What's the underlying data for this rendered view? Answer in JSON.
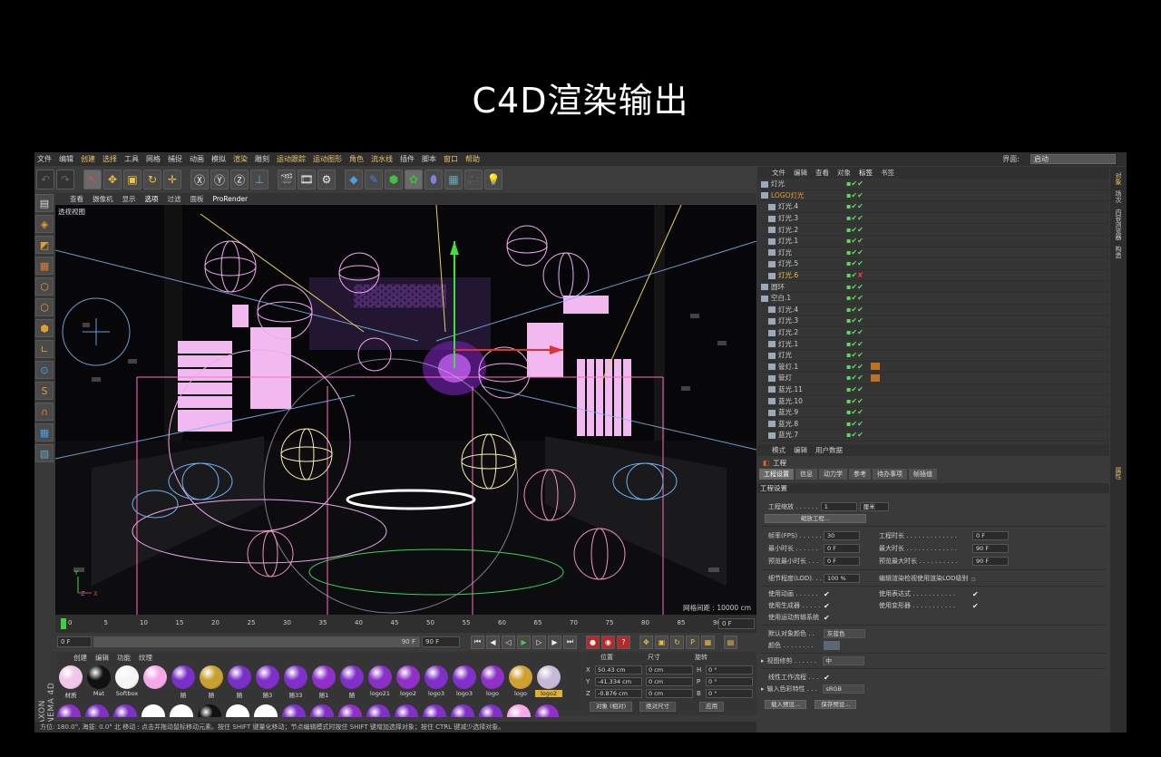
{
  "page_title": "C4D渲染输出",
  "menu": [
    "文件",
    "编辑",
    "创建",
    "选择",
    "工具",
    "网格",
    "捕捉",
    "动画",
    "模拟",
    "渲染",
    "雕刻",
    "运动跟踪",
    "运动图形",
    "角色",
    "流水线",
    "插件",
    "脚本",
    "窗口",
    "帮助"
  ],
  "interface": {
    "label": "界面:",
    "value": "启动"
  },
  "viewport": {
    "menu": [
      "查看",
      "摄像机",
      "显示",
      "选项",
      "过滤",
      "面板",
      "ProRender"
    ],
    "label": "透视视图",
    "grid_label": "网格间距 : 10000 cm"
  },
  "timeline": {
    "ticks": [
      "0",
      "5",
      "10",
      "15",
      "20",
      "25",
      "30",
      "35",
      "40",
      "45",
      "50",
      "55",
      "60",
      "65",
      "70",
      "75",
      "80",
      "85",
      "90"
    ],
    "current_frame": "0 F",
    "start": "0 F",
    "end": "90 F",
    "end2": "90 F"
  },
  "materials": {
    "menu": [
      "创建",
      "编辑",
      "功能",
      "纹理"
    ],
    "items": [
      {
        "name": "材质",
        "color": "#f2c6e8"
      },
      {
        "name": "Mat",
        "color": "#111111"
      },
      {
        "name": "Softbox",
        "color": "#f4f4f4"
      },
      {
        "name": "",
        "color": "#f4a8e8"
      },
      {
        "name": "随",
        "color": "#7a30c8"
      },
      {
        "name": "随",
        "color": "#c8a030"
      },
      {
        "name": "随",
        "color": "#7a30c8"
      },
      {
        "name": "随3",
        "color": "#8030c8"
      },
      {
        "name": "随33",
        "color": "#8030c8"
      },
      {
        "name": "随1",
        "color": "#9030c8"
      },
      {
        "name": "随",
        "color": "#8030c8"
      },
      {
        "name": "logo21",
        "color": "#8a30c8"
      },
      {
        "name": "logo2",
        "color": "#9030c8"
      },
      {
        "name": "logo3",
        "color": "#8030c8"
      },
      {
        "name": "logo3",
        "color": "#8030c8"
      },
      {
        "name": "logo",
        "color": "#9030c8"
      },
      {
        "name": "logo",
        "color": "#d0a030"
      },
      {
        "name": "logo2",
        "color": "#c8b8d8"
      }
    ]
  },
  "coords": {
    "headers": [
      "位置",
      "尺寸",
      "旋转"
    ],
    "rows": [
      {
        "axis": "X",
        "pos": "50.43 cm",
        "size": "0 cm",
        "rot_axis": "H",
        "rot": "0 °"
      },
      {
        "axis": "Y",
        "pos": "-41.334 cm",
        "size": "0 cm",
        "rot_axis": "P",
        "rot": "0 °"
      },
      {
        "axis": "Z",
        "pos": "-0.876 cm",
        "size": "0 cm",
        "rot_axis": "B",
        "rot": "0 °"
      }
    ],
    "mode": "对象 (相对)",
    "size_mode": "绝对尺寸",
    "apply": "应用"
  },
  "status": "方位: 180.0°, 海拔: 0.0° 北   移动 : 点击并拖动鼠标移动元素。按住 SHIFT 键量化移动；节点编辑模式时按住 SHIFT 键增加选择对象；按住 CTRL 键减少选择对象。",
  "brand": "MAXON CINEMA 4D",
  "objects": {
    "menu": [
      "文件",
      "编辑",
      "查看",
      "对象",
      "标签",
      "书签"
    ],
    "items": [
      {
        "name": "灯光",
        "style": ""
      },
      {
        "name": "LOGO灯光",
        "style": "or"
      },
      {
        "name": "灯光.4",
        "style": ""
      },
      {
        "name": "灯光.3",
        "style": ""
      },
      {
        "name": "灯光.2",
        "style": ""
      },
      {
        "name": "灯光.1",
        "style": ""
      },
      {
        "name": "灯光",
        "style": ""
      },
      {
        "name": "灯光.5",
        "style": ""
      },
      {
        "name": "灯光.6",
        "style": "yl"
      },
      {
        "name": "圆环",
        "style": ""
      },
      {
        "name": "空白.1",
        "style": ""
      },
      {
        "name": "灯光.4",
        "style": ""
      },
      {
        "name": "灯光.3",
        "style": ""
      },
      {
        "name": "灯光.2",
        "style": ""
      },
      {
        "name": "灯光.1",
        "style": ""
      },
      {
        "name": "灯光",
        "style": ""
      },
      {
        "name": "管灯.1",
        "style": ""
      },
      {
        "name": "管灯",
        "style": ""
      },
      {
        "name": "蓝光.11",
        "style": ""
      },
      {
        "name": "蓝光.10",
        "style": ""
      },
      {
        "name": "蓝光.9",
        "style": ""
      },
      {
        "name": "蓝光.8",
        "style": ""
      },
      {
        "name": "蓝光.7",
        "style": ""
      }
    ]
  },
  "right_strip": [
    "对象",
    "场次",
    "内容浏览器",
    "构造"
  ],
  "attr_strip": "属性",
  "attributes": {
    "menu": [
      "模式",
      "编辑",
      "用户数据"
    ],
    "header": "工程",
    "tabs": [
      "工程设置",
      "信息",
      "动力学",
      "参考",
      "待办事项",
      "帧插值"
    ],
    "section": "工程设置",
    "scale_label": "工程缩放 . . . . . .",
    "scale_value": "1",
    "scale_unit": "厘米",
    "scale_button": "缩放工程...",
    "fps_label": "帧率(FPS) . . . . . .",
    "fps": "30",
    "project_time_label": "工程时长 . . . . . . . . . . . . .",
    "project_time": "0 F",
    "min_time_label": "最小时长 . . . . . .",
    "min_time": "0 F",
    "max_time_label": "最大时长 . . . . . . . . . . . . .",
    "max_time": "90 F",
    "prev_min_label": "预览最小时长 . . .",
    "prev_min": "0 F",
    "prev_max_label": "预览最大时长 . . . . . . . . . .",
    "prev_max": "90 F",
    "lod_label": "细节程度(LOD). . . .",
    "lod": "100 %",
    "lod_edit_label": "编辑渲染检视使用渲染LOD级别",
    "use_anim_label": "使用动画 . . . . . .",
    "use_expr_label": "使用表达式 . . . . . . . . . . .",
    "use_gen_label": "使用生成器 . . . . .",
    "use_deform_label": "使用变形器 . . . . . . . . . . .",
    "use_motion_label": "使用运动剪辑系统",
    "default_color_label": "默认对象颜色 . .",
    "default_color": "灰蓝色",
    "color_label": "颜色 . . . . . . . .",
    "view_clip_label": "视图修剪 . . . . . .",
    "view_clip": "中",
    "linear_label": "线性工作流程 . . .",
    "input_color_label": "输入色彩特性 . . .",
    "input_color": "sRGB",
    "load_preset": "载入预设...",
    "save_preset": "保存预设..."
  }
}
